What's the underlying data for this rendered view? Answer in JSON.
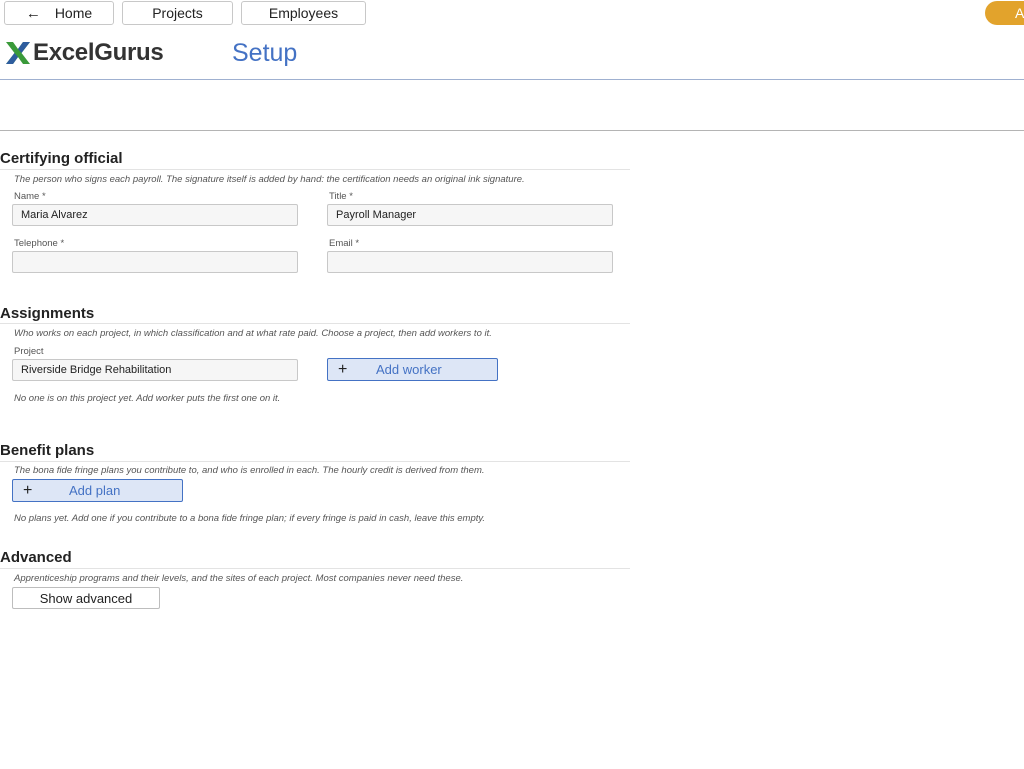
{
  "nav": {
    "home_label": "Home",
    "home_icon": "arrow-left-icon",
    "projects_label": "Projects",
    "employees_label": "Employees",
    "pill_label": "A"
  },
  "brand": {
    "logo_text": "ExcelGurus",
    "page_title": "Setup",
    "colors": {
      "accent_blue": "#4472c4",
      "logo_green": "#3a9a3a",
      "logo_blue": "#2e5d9e",
      "pill_orange": "#e2a32c"
    }
  },
  "certifying": {
    "title": "Certifying official",
    "hint": "The person who signs each payroll. The signature itself is added by hand: the certification needs an original ink signature.",
    "name_label": "Name *",
    "name_value": "Maria Alvarez",
    "title_label": "Title *",
    "title_value": "Payroll Manager",
    "telephone_label": "Telephone *",
    "telephone_value": "",
    "email_label": "Email *",
    "email_value": ""
  },
  "assignments": {
    "title": "Assignments",
    "hint": "Who works on each project, in which classification and at what rate paid. Choose a project, then add workers to it.",
    "project_label": "Project",
    "project_value": "Riverside Bridge Rehabilitation",
    "add_worker_label": "Add worker",
    "empty_text": "No one is on this project yet. Add worker puts the first one on it."
  },
  "benefits": {
    "title": "Benefit plans",
    "hint": "The bona fide fringe plans you contribute to, and who is enrolled in each. The hourly credit is derived from them.",
    "add_plan_label": "Add plan",
    "empty_text": "No plans yet. Add one if you contribute to a bona fide fringe plan; if every fringe is paid in cash, leave this empty."
  },
  "advanced": {
    "title": "Advanced",
    "hint": "Apprenticeship programs and their levels, and the sites of each project. Most companies never need these.",
    "show_label": "Show advanced"
  }
}
